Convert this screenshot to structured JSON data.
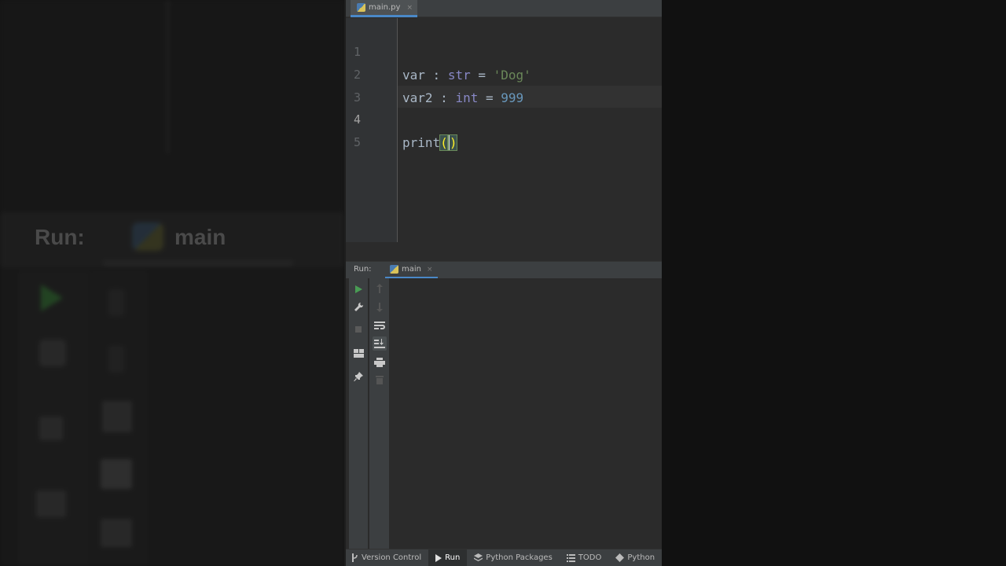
{
  "background": {
    "run_label": "Run:",
    "tab_label": "main"
  },
  "editor": {
    "tab": {
      "label": "main.py",
      "close": "×",
      "icon": "python-file-icon"
    },
    "lines": [
      {
        "number": "1",
        "tokens": {
          "name": "var",
          "colon": " : ",
          "type": "str",
          "eq": " = ",
          "value": "'Dog'"
        }
      },
      {
        "number": "2",
        "tokens": {
          "name": "var2",
          "colon": " : ",
          "type": "int",
          "eq": " = ",
          "value": "999"
        }
      },
      {
        "number": "3"
      },
      {
        "number": "4",
        "tokens": {
          "fn": "print",
          "open": "(",
          "close": ")"
        }
      },
      {
        "number": "5"
      }
    ],
    "active_line": "4"
  },
  "run_panel": {
    "label": "Run:",
    "tab": {
      "label": "main",
      "close": "×",
      "icon": "python-file-icon"
    },
    "toolbar_left": [
      "run-icon",
      "wrench-icon",
      "stop-icon",
      "layout-icon",
      "pin-icon"
    ],
    "toolbar_right": [
      "arrow-up-icon",
      "arrow-down-icon",
      "soft-wrap-icon",
      "scroll-to-end-icon",
      "print-icon",
      "trash-icon"
    ]
  },
  "statusbar": {
    "items": [
      {
        "label": "Version Control",
        "icon": "branch-icon"
      },
      {
        "label": "Run",
        "icon": "run-icon",
        "active": true
      },
      {
        "label": "Python Packages",
        "icon": "layers-icon"
      },
      {
        "label": "TODO",
        "icon": "list-icon"
      },
      {
        "label": "Python",
        "icon": "python-icon"
      }
    ]
  },
  "colors": {
    "editor_bg": "#2b2b2b",
    "panel_bg": "#3c3f41",
    "string": "#6a8759",
    "number": "#6897bb",
    "builtin_type": "#8888c6",
    "identifier": "#a9b7c6",
    "accent": "#4a88c7",
    "run_green": "#499c54"
  }
}
